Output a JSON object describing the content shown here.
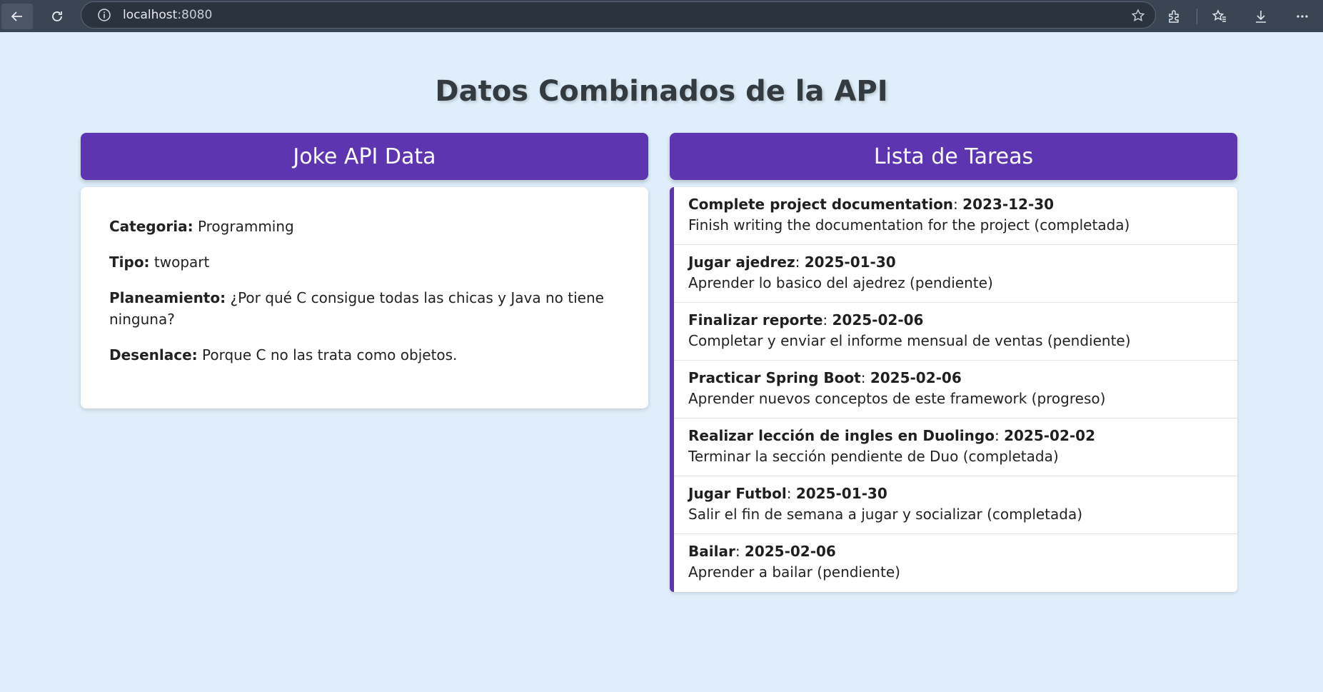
{
  "browser": {
    "url_host": "localhost",
    "url_port": ":8080"
  },
  "page": {
    "title": "Datos Combinados de la API"
  },
  "joke": {
    "header": "Joke API Data",
    "fields": [
      {
        "key": "Categoria:",
        "value": "Programming"
      },
      {
        "key": "Tipo:",
        "value": "twopart"
      },
      {
        "key": "Planeamiento:",
        "value": "¿Por qué C consigue todas las chicas y Java no tiene ninguna?"
      },
      {
        "key": "Desenlace:",
        "value": "Porque C no las trata como objetos."
      }
    ]
  },
  "tasks": {
    "header": "Lista de Tareas",
    "items": [
      {
        "title": "Complete project documentation",
        "date": "2023-12-30",
        "description": "Finish writing the documentation for the project",
        "status": "completada"
      },
      {
        "title": "Jugar ajedrez",
        "date": "2025-01-30",
        "description": "Aprender lo basico del ajedrez",
        "status": "pendiente"
      },
      {
        "title": "Finalizar reporte",
        "date": "2025-02-06",
        "description": "Completar y enviar el informe mensual de ventas",
        "status": "pendiente"
      },
      {
        "title": "Practicar Spring Boot",
        "date": "2025-02-06",
        "description": "Aprender nuevos conceptos de este framework",
        "status": "progreso"
      },
      {
        "title": "Realizar lección de ingles en Duolingo",
        "date": "2025-02-02",
        "description": "Terminar la sección pendiente de Duo",
        "status": "completada"
      },
      {
        "title": "Jugar Futbol",
        "date": "2025-01-30",
        "description": "Salir el fin de semana a jugar y socializar",
        "status": "completada"
      },
      {
        "title": "Bailar",
        "date": "2025-02-06",
        "description": "Aprender a bailar",
        "status": "pendiente"
      }
    ]
  },
  "icons": {
    "back": "back-arrow-icon",
    "reload": "reload-icon",
    "info": "info-icon",
    "favorite": "star-icon",
    "extensions": "extensions-icon",
    "favorites": "favorites-icon",
    "downloads": "download-icon",
    "menu": "more-icon"
  },
  "colors": {
    "accent": "#5e35b1",
    "background": "#dfeefa"
  }
}
